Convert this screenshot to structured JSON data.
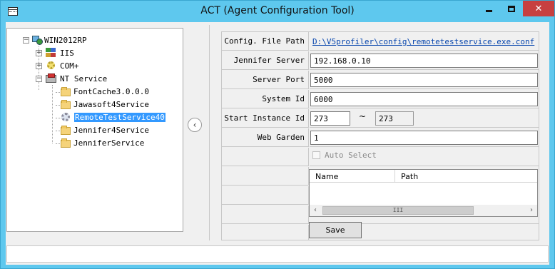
{
  "window": {
    "title": "ACT (Agent Configuration Tool)",
    "controls": {
      "minimize_icon": "minimize-icon",
      "maximize_icon": "maximize-icon",
      "close_glyph": "✕"
    }
  },
  "tree": {
    "root": {
      "label": "WIN2012RP",
      "icon": "server-icon"
    },
    "nodes": [
      {
        "label": "IIS",
        "icon": "iis-icon"
      },
      {
        "label": "COM+",
        "icon": "com-icon"
      },
      {
        "label": "NT Service",
        "icon": "nt-service-icon"
      }
    ],
    "services": [
      {
        "label": "FontCache3.0.0.0",
        "icon": "folder-icon",
        "selected": false
      },
      {
        "label": "Jawasoft4Service",
        "icon": "folder-icon",
        "selected": false
      },
      {
        "label": "RemoteTestService40",
        "icon": "service-gear-icon",
        "selected": true
      },
      {
        "label": "Jennifer4Service",
        "icon": "folder-icon",
        "selected": false
      },
      {
        "label": "JenniferService",
        "icon": "folder-icon",
        "selected": false
      }
    ]
  },
  "collapse_glyph": "‹",
  "form": {
    "config_path": {
      "label": "Config. File Path",
      "value": "D:\\V5profiler\\config\\remotetestservice.exe.conf"
    },
    "jennifer_server": {
      "label": "Jennifer Server",
      "value": "192.168.0.10"
    },
    "server_port": {
      "label": "Server Port",
      "value": "5000"
    },
    "system_id": {
      "label": "System Id",
      "value": "6000"
    },
    "start_instance": {
      "label": "Start Instance Id",
      "from": "273",
      "separator": "~",
      "to": "273"
    },
    "web_garden": {
      "label": "Web Garden",
      "value": "1"
    },
    "auto_select": {
      "label": "Auto Select",
      "checked": false
    }
  },
  "grid": {
    "columns": [
      "Name",
      "Path"
    ],
    "scroll_left": "‹",
    "scroll_right": "›",
    "thumb_grip": "III"
  },
  "save_label": "Save",
  "status_text": ""
}
